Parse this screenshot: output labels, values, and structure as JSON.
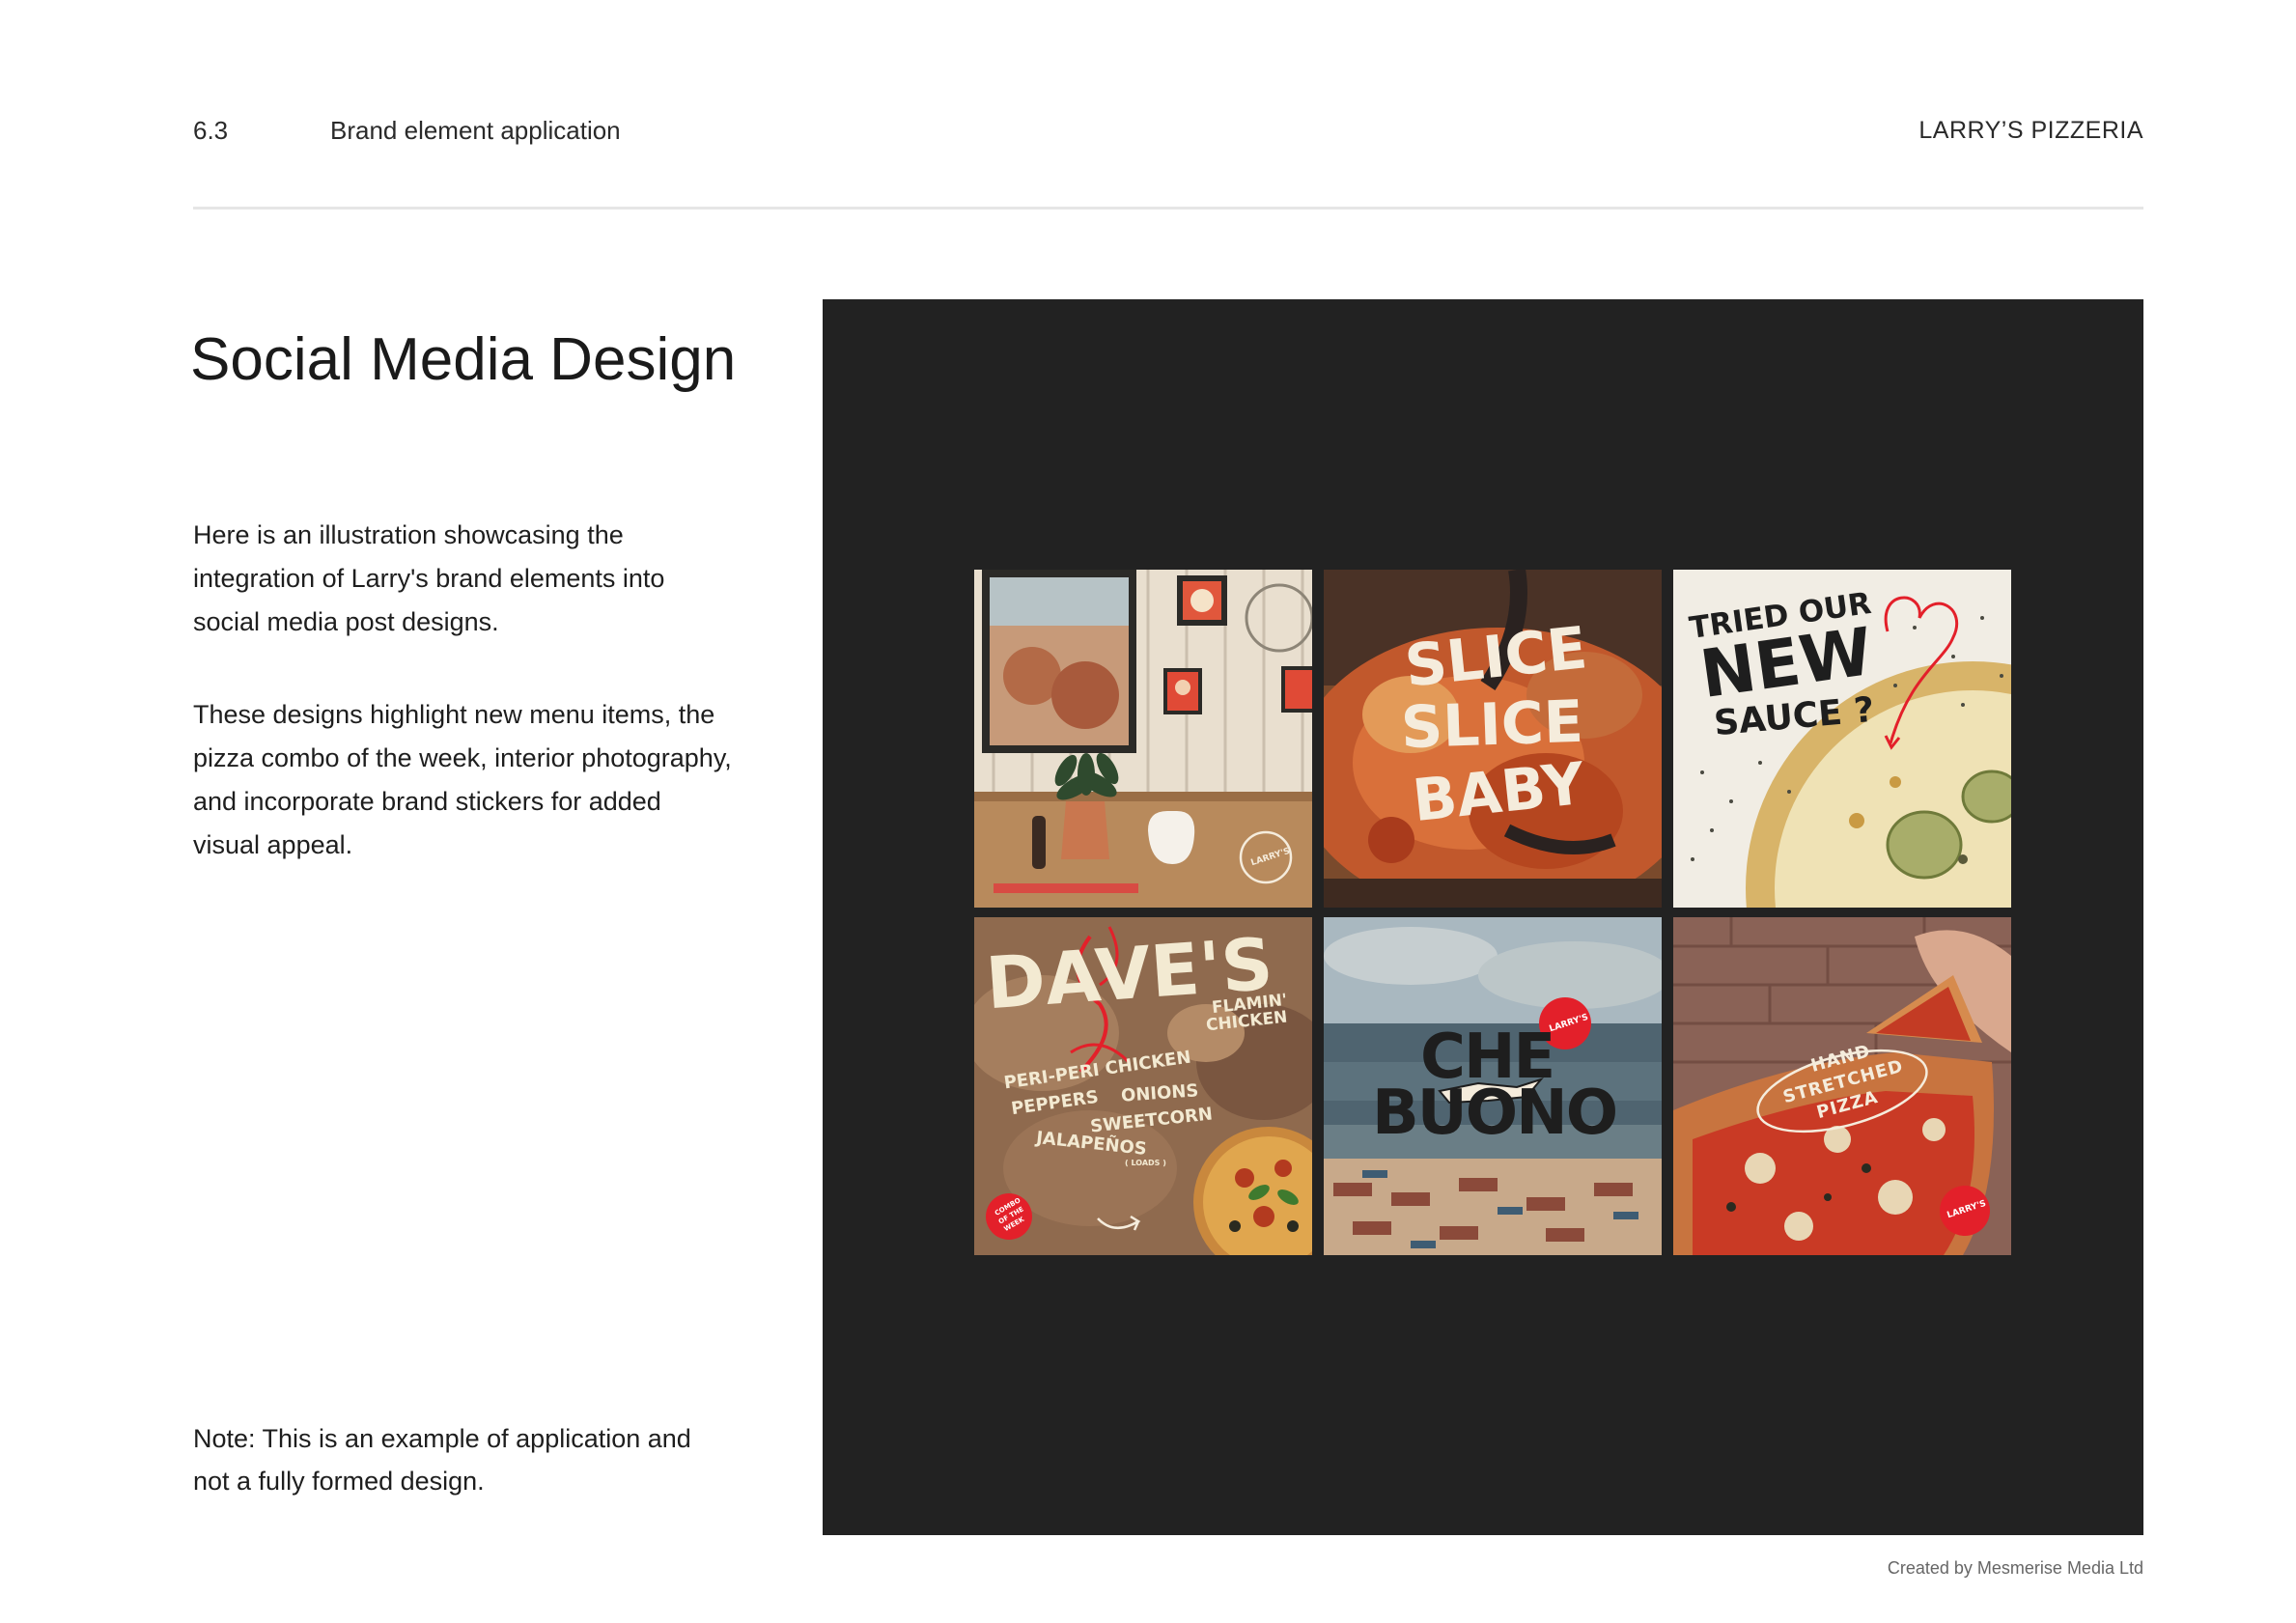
{
  "header": {
    "section_number": "6.3",
    "section_title": "Brand element application",
    "brand": "LARRY’S PIZZERIA"
  },
  "main": {
    "title": "Social Media Design",
    "paragraphs": [
      "Here is an illustration showcasing the integration of Larry's brand elements into social media post designs.",
      "These designs highlight new menu items, the pizza combo of the week, interior photography, and incorporate brand stickers for added visual appeal."
    ],
    "note": "Note: This is an example of application and not a fully formed design."
  },
  "posts": {
    "interior": {
      "sticker": "LARRY'S"
    },
    "slice": {
      "line1": "SLICE",
      "line2": "SLICE",
      "line3": "BABY"
    },
    "sauce": {
      "line1": "TRIED OUR",
      "line2": "NEW",
      "line3": "SAUCE ?"
    },
    "daves": {
      "title": "DAVE'S",
      "subtitle1": "FLAMIN'",
      "subtitle2": "CHICKEN",
      "items": [
        "PERI-PERI CHICKEN",
        "PEPPERS",
        "ONIONS",
        "SWEETCORN",
        "JALAPEÑOS"
      ],
      "loads": "( LOADS )",
      "badge1": "COMBO",
      "badge2": "OF THE",
      "badge3": "WEEK"
    },
    "buono": {
      "line1": "CHE",
      "line2": "BUONO",
      "sticker": "LARRY'S"
    },
    "hand": {
      "line1": "HAND",
      "line2": "STRETCHED",
      "line3": "PIZZA",
      "sticker": "LARRY'S"
    }
  },
  "colors": {
    "panel": "#222222",
    "brand_red": "#e3202a",
    "cream": "#f3ead2",
    "dark_text": "#1e1e1e"
  },
  "footer": {
    "credit": "Created by Mesmerise Media Ltd"
  }
}
